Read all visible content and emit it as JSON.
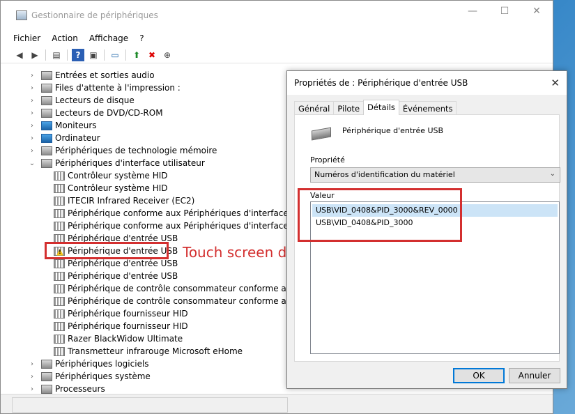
{
  "window": {
    "title": "Gestionnaire de périphériques",
    "controls": {
      "minimize": "—",
      "maximize": "☐",
      "close": "✕"
    }
  },
  "menu": [
    "Fichier",
    "Action",
    "Affichage",
    "?"
  ],
  "toolbar": [
    "back-icon",
    "forward-icon",
    "properties-icon",
    "help-icon",
    "scan-icon",
    "monitor-icon",
    "enable-icon",
    "remove-icon",
    "update-icon"
  ],
  "tree": [
    {
      "label": "Entrées et sorties audio",
      "level": 0,
      "expander": ">",
      "icon": "audio-icon"
    },
    {
      "label": "Files d'attente à l'impression :",
      "level": 0,
      "expander": ">",
      "icon": "printer-icon"
    },
    {
      "label": "Lecteurs de disque",
      "level": 0,
      "expander": ">",
      "icon": "disk-icon"
    },
    {
      "label": "Lecteurs de DVD/CD-ROM",
      "level": 0,
      "expander": ">",
      "icon": "dvd-icon"
    },
    {
      "label": "Moniteurs",
      "level": 0,
      "expander": ">",
      "icon": "monitor-icon"
    },
    {
      "label": "Ordinateur",
      "level": 0,
      "expander": ">",
      "icon": "computer-icon"
    },
    {
      "label": "Périphériques de technologie mémoire",
      "level": 0,
      "expander": ">",
      "icon": "memory-icon"
    },
    {
      "label": "Périphériques d'interface utilisateur",
      "level": 0,
      "expander": "v",
      "icon": "hid-icon"
    },
    {
      "label": "Contrôleur système HID",
      "level": 1,
      "icon": "hid-icon"
    },
    {
      "label": "Contrôleur système HID",
      "level": 1,
      "icon": "hid-icon"
    },
    {
      "label": "ITECIR Infrared Receiver (EC2)",
      "level": 1,
      "icon": "hid-icon"
    },
    {
      "label": "Périphérique conforme aux Périphériques d'interface utilisat",
      "level": 1,
      "icon": "hid-icon"
    },
    {
      "label": "Périphérique conforme aux Périphériques d'interface utilisat",
      "level": 1,
      "icon": "hid-icon"
    },
    {
      "label": "Périphérique d'entrée USB",
      "level": 1,
      "icon": "hid-icon"
    },
    {
      "label": "Périphérique d'entrée USB",
      "level": 1,
      "icon": "hid-warning-icon",
      "warning": true
    },
    {
      "label": "Périphérique d'entrée USB",
      "level": 1,
      "icon": "hid-icon"
    },
    {
      "label": "Périphérique d'entrée USB",
      "level": 1,
      "icon": "hid-icon"
    },
    {
      "label": "Périphérique de contrôle consommateur conforme aux Périp",
      "level": 1,
      "icon": "hid-icon"
    },
    {
      "label": "Périphérique de contrôle consommateur conforme aux Périp",
      "level": 1,
      "icon": "hid-icon"
    },
    {
      "label": "Périphérique fournisseur HID",
      "level": 1,
      "icon": "hid-icon"
    },
    {
      "label": "Périphérique fournisseur HID",
      "level": 1,
      "icon": "hid-icon"
    },
    {
      "label": "Razer BlackWidow Ultimate",
      "level": 1,
      "icon": "hid-icon"
    },
    {
      "label": "Transmetteur infrarouge Microsoft eHome",
      "level": 1,
      "icon": "hid-icon"
    },
    {
      "label": "Périphériques logiciels",
      "level": 0,
      "expander": ">",
      "icon": "software-device-icon"
    },
    {
      "label": "Périphériques système",
      "level": 0,
      "expander": ">",
      "icon": "system-device-icon"
    },
    {
      "label": "Processeurs",
      "level": 0,
      "expander": ">",
      "icon": "processor-icon"
    }
  ],
  "annotation": "Touch screen driver",
  "dialog": {
    "title": "Propriétés de : Périphérique d'entrée USB",
    "close": "✕",
    "tabs": [
      "Général",
      "Pilote",
      "Détails",
      "Événements"
    ],
    "active_tab": "Détails",
    "device_name": "Périphérique d'entrée USB",
    "property_label": "Propriété",
    "property_value": "Numéros d'identification du matériel",
    "value_label": "Valeur",
    "values": [
      "USB\\VID_0408&PID_3000&REV_0000",
      "USB\\VID_0408&PID_3000"
    ],
    "ok": "OK",
    "cancel": "Annuler"
  },
  "colors": {
    "annotation_red": "#d32f2f",
    "selection": "#cce4f7",
    "accent": "#0078d7"
  }
}
